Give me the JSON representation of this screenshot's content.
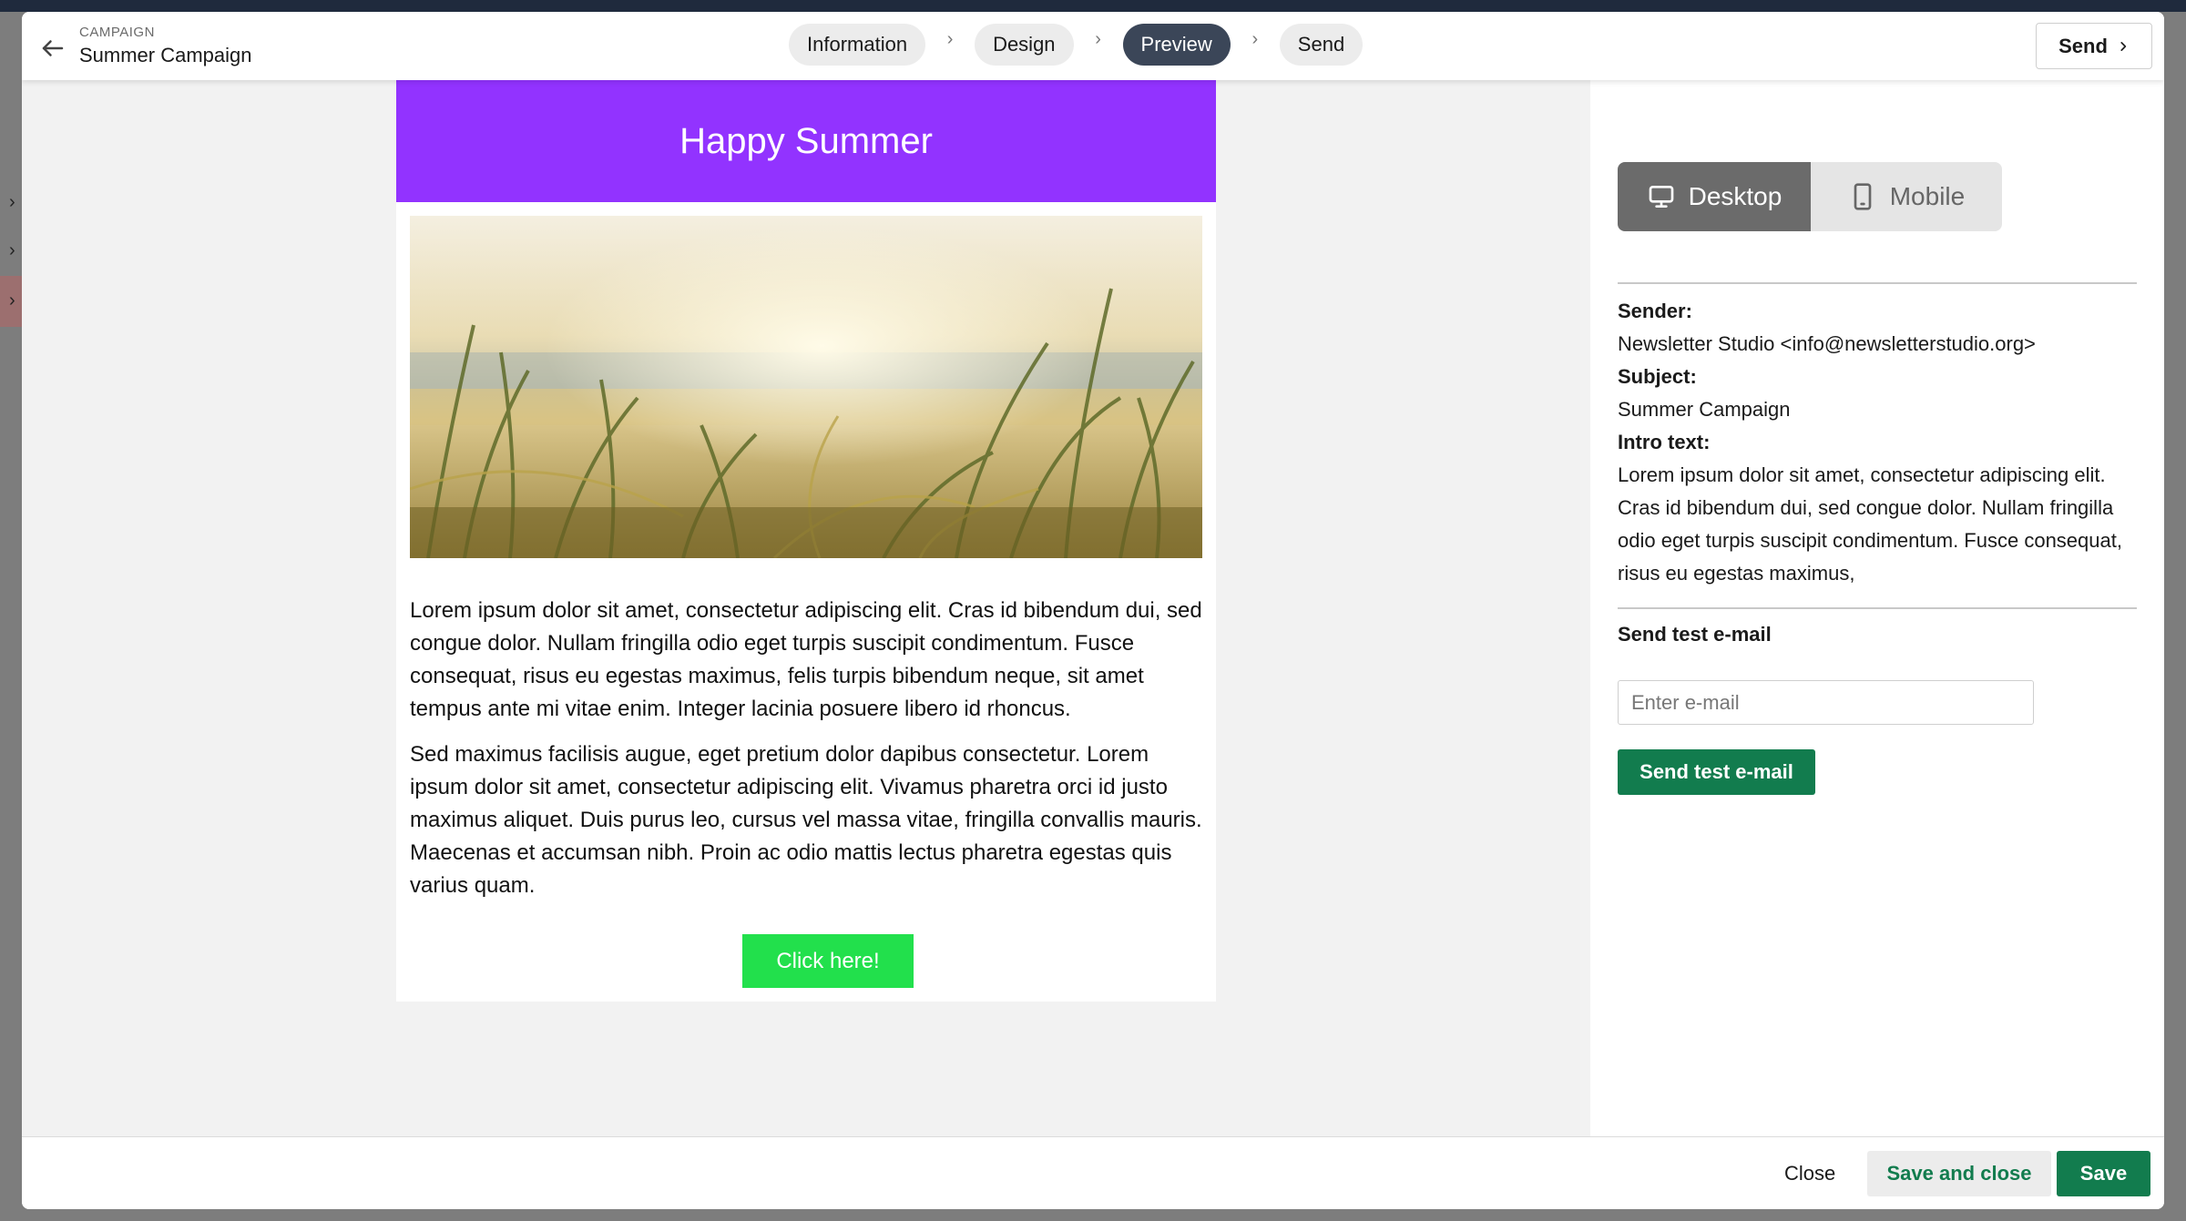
{
  "header": {
    "eyebrow": "CAMPAIGN",
    "title": "Summer Campaign",
    "send_label": "Send"
  },
  "steps": [
    {
      "label": "Information",
      "active": false
    },
    {
      "label": "Design",
      "active": false
    },
    {
      "label": "Preview",
      "active": true
    },
    {
      "label": "Send",
      "active": false
    }
  ],
  "email": {
    "headline": "Happy Summer",
    "header_color": "#9233ff",
    "paragraphs": [
      "Lorem ipsum dolor sit amet, consectetur adipiscing elit. Cras id bibendum dui, sed congue dolor. Nullam fringilla odio eget turpis suscipit condimentum. Fusce consequat, risus eu egestas maximus, felis turpis bibendum neque, sit amet tempus ante mi vitae enim. Integer lacinia posuere libero id rhoncus.",
      "Sed maximus facilisis augue, eget pretium dolor dapibus consectetur. Lorem ipsum dolor sit amet, consectetur adipiscing elit. Vivamus pharetra orci id justo maximus aliquet. Duis purus leo, cursus vel massa vitae, fringilla convallis mauris. Maecenas et accumsan nibh. Proin ac odio mattis lectus pharetra egestas quis varius quam."
    ],
    "cta_label": "Click here!",
    "cta_color": "#22e04c"
  },
  "panel": {
    "desktop_label": "Desktop",
    "mobile_label": "Mobile",
    "active_device": "Desktop",
    "sender_label": "Sender:",
    "sender_value": "Newsletter Studio <info@newsletterstudio.org>",
    "subject_label": "Subject:",
    "subject_value": "Summer Campaign",
    "intro_label": "Intro text:",
    "intro_value": "Lorem ipsum dolor sit amet, consectetur adipiscing elit. Cras id bibendum dui, sed congue dolor. Nullam fringilla odio eget turpis suscipit condimentum. Fusce consequat, risus eu egestas maximus,",
    "test_title": "Send test e-mail",
    "test_placeholder": "Enter e-mail",
    "test_button": "Send test e-mail"
  },
  "footer": {
    "close_label": "Close",
    "save_close_label": "Save and close",
    "save_label": "Save"
  },
  "colors": {
    "primary_green": "#127c4e",
    "active_step": "#3b4658"
  }
}
